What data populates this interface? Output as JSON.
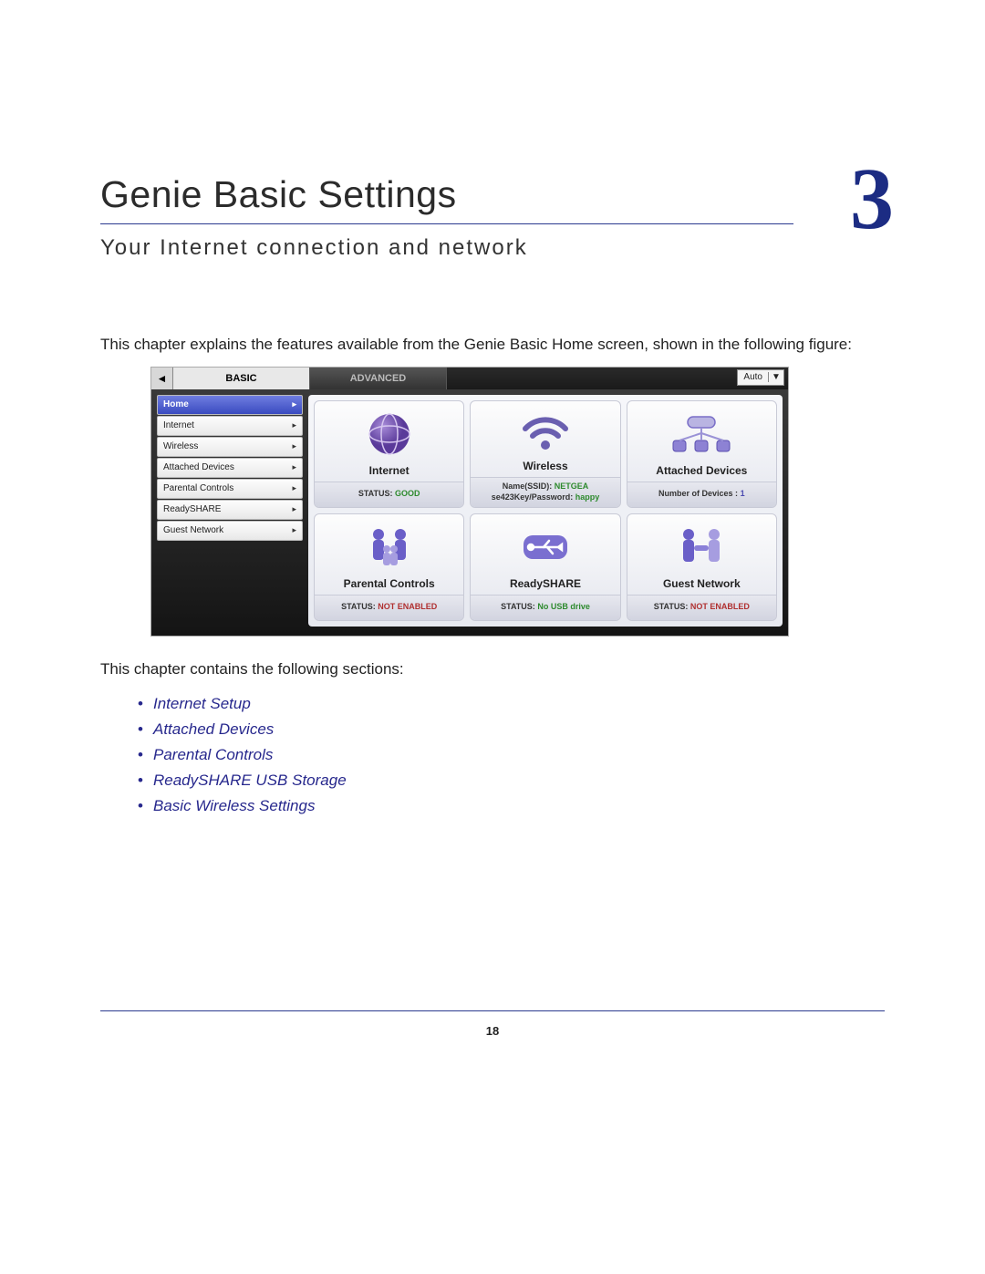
{
  "chapter": {
    "title": "Genie Basic Settings",
    "number": "3",
    "subtitle": "Your Internet connection and network"
  },
  "intro": "This chapter explains the features available from the Genie Basic Home screen, shown in the following figure:",
  "figure": {
    "tab_basic": "BASIC",
    "tab_advanced": "ADVANCED",
    "lang_value": "Auto",
    "sidebar": [
      "Home",
      "Internet",
      "Wireless",
      "Attached Devices",
      "Parental Controls",
      "ReadySHARE",
      "Guest Network"
    ],
    "tiles": {
      "internet": {
        "title": "Internet",
        "status_label": "STATUS:",
        "status_value": "GOOD"
      },
      "wireless": {
        "title": "Wireless",
        "line1_label": "Name(SSID):",
        "line1_value": "NETGEA",
        "line2_prefix": "se423",
        "line2_label": "Key/Password:",
        "line2_value": "happy"
      },
      "attached": {
        "title": "Attached Devices",
        "status_label": "Number of Devices :",
        "status_value": "1"
      },
      "parental": {
        "title": "Parental Controls",
        "status_label": "STATUS:",
        "status_value": "NOT ENABLED"
      },
      "readyshare": {
        "title": "ReadySHARE",
        "status_label": "STATUS:",
        "status_value": "No USB drive"
      },
      "guest": {
        "title": "Guest Network",
        "status_label": "STATUS:",
        "status_value": "NOT ENABLED"
      }
    }
  },
  "sections_intro": "This chapter contains the following sections:",
  "toc": [
    "Internet Setup",
    "Attached Devices",
    "Parental Controls",
    "ReadySHARE USB Storage",
    "Basic Wireless Settings"
  ],
  "page_number": "18"
}
